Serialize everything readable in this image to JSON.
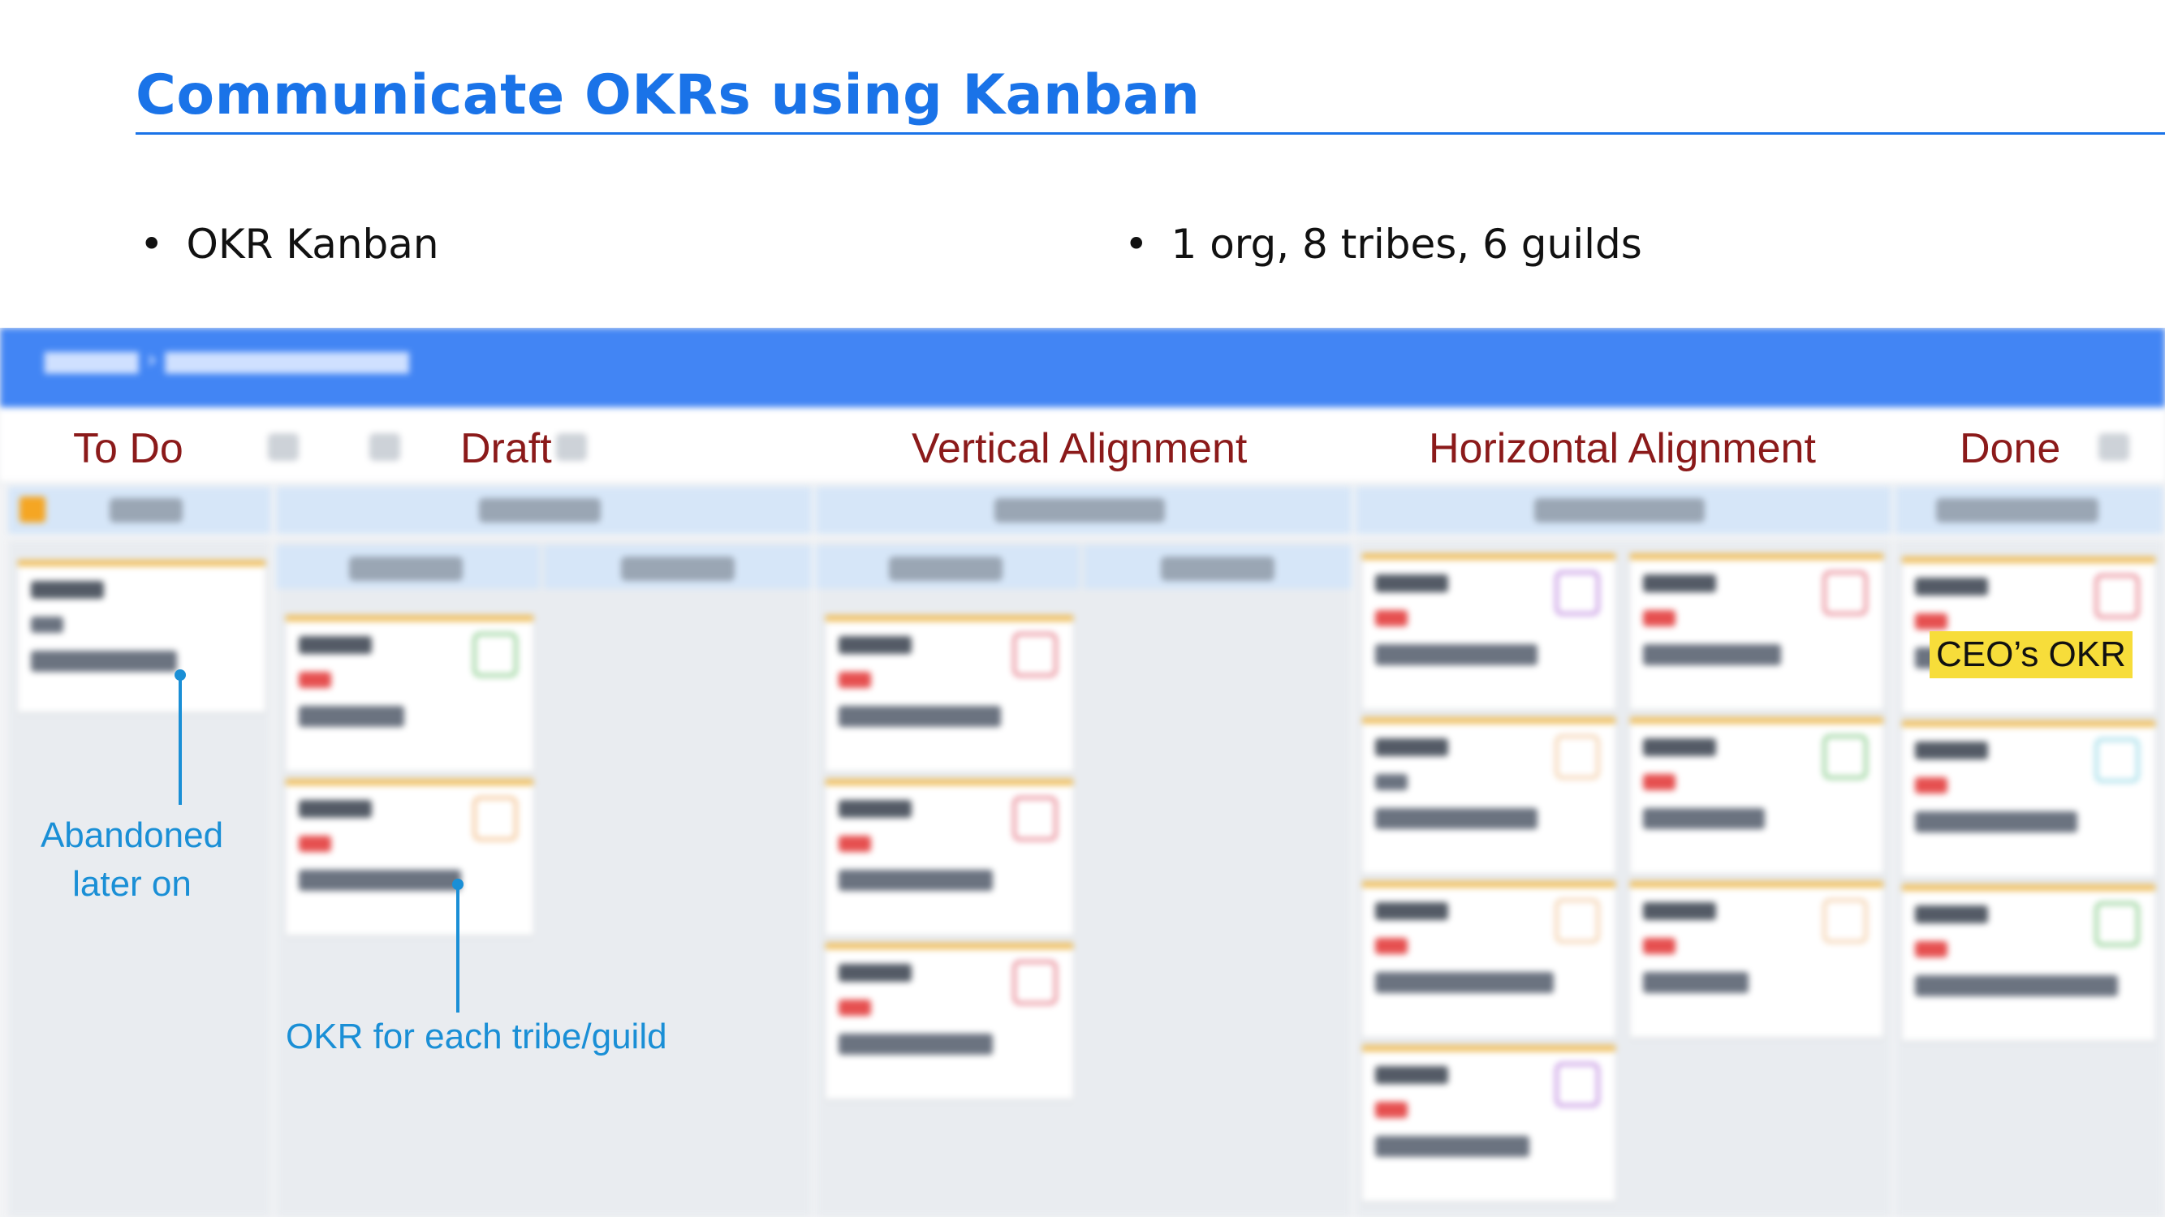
{
  "slide": {
    "title": "Communicate OKRs using Kanban",
    "bullets": [
      "OKR Kanban",
      "1 org, 8 tribes, 6 guilds"
    ],
    "bullet_symbol": "•"
  },
  "columns": {
    "to_do": "To Do",
    "draft": "Draft",
    "vertical_alignment": "Vertical Alignment",
    "horizontal_alignment": "Horizontal Alignment",
    "done": "Done"
  },
  "annotations": {
    "abandoned": "Abandoned later on",
    "okr_each": "OKR for each tribe/guild",
    "ceo_okr": "CEO’s OKR"
  },
  "colors": {
    "title_blue": "#1a73e8",
    "column_label": "#8b1a1a",
    "annotation_blue": "#1a8fd6",
    "highlight_yellow": "#f7dd3a",
    "kanban_header": "#4285f4"
  }
}
